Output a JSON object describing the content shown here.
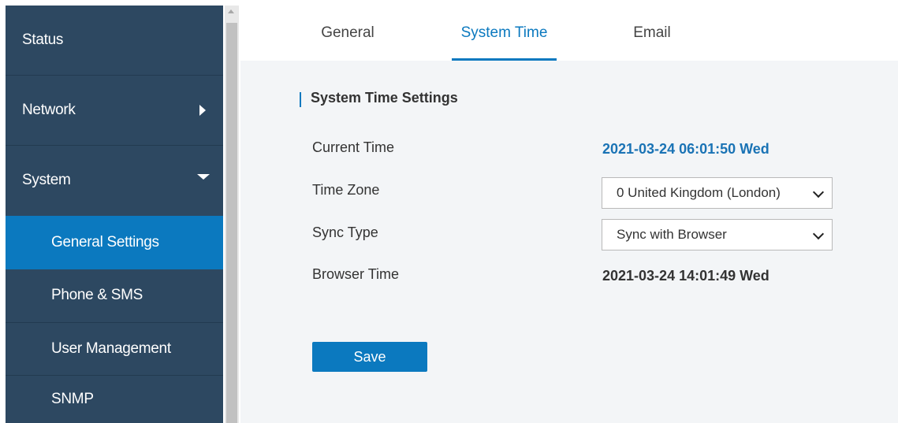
{
  "sidebar": {
    "items": [
      {
        "label": "Status"
      },
      {
        "label": "Network",
        "icon": "chevron-right-icon"
      },
      {
        "label": "System",
        "icon": "chevron-down-icon"
      },
      {
        "label": "General Settings",
        "active": true
      },
      {
        "label": "Phone & SMS"
      },
      {
        "label": "User Management"
      },
      {
        "label": "SNMP"
      }
    ]
  },
  "tabs": [
    {
      "label": "General"
    },
    {
      "label": "System Time",
      "active": true
    },
    {
      "label": "Email"
    }
  ],
  "section": {
    "title": "System Time Settings"
  },
  "fields": {
    "current_time": {
      "label": "Current Time",
      "value": "2021-03-24 06:01:50 Wed"
    },
    "time_zone": {
      "label": "Time Zone",
      "value": "0 United Kingdom (London)"
    },
    "sync_type": {
      "label": "Sync Type",
      "value": "Sync with Browser"
    },
    "browser_time": {
      "label": "Browser Time",
      "value": "2021-03-24 14:01:49 Wed"
    }
  },
  "save_label": "Save",
  "colors": {
    "sidebar_bg": "#2d4861",
    "accent": "#0b79bf",
    "content_bg": "#f3f5f7",
    "link_value": "#1a73b5"
  }
}
